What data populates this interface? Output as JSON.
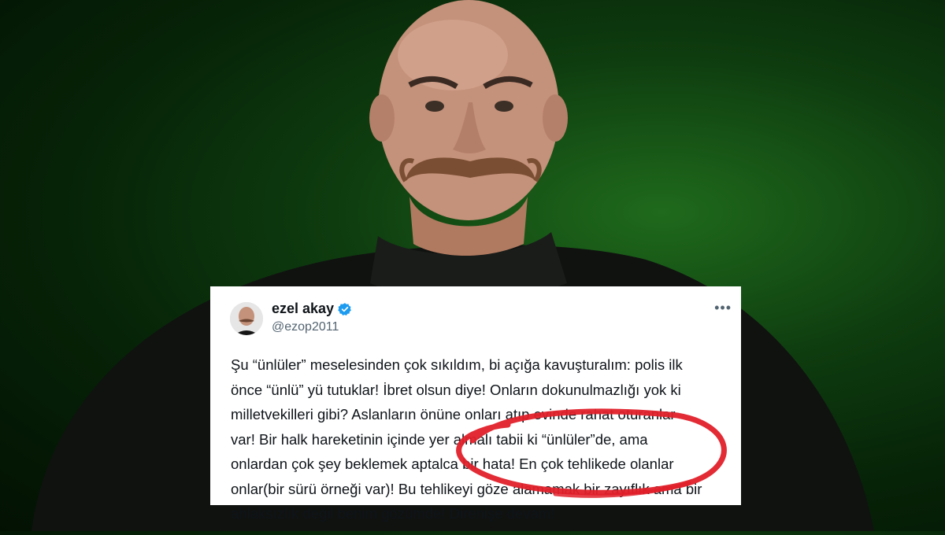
{
  "tweet": {
    "author_name": "ezel akay",
    "handle": "@ezop2011",
    "text": "Şu “ünlüler” meselesinden çok sıkıldım, bi açığa kavuşturalım: polis ilk\nönce “ünlü” yü tutuklar! İbret olsun diye! Onların dokunulmazlığı yok ki\nmilletvekilleri gibi? Aslanların önüne onları atıp evinde rahat oturanlar\nvar! Bir halk hareketinin içinde yer almalı tabii ki “ünlüler”de, ama\nonlardan çok şey beklemek aptalca bir hata! En çok tehlikede olanlar\nonlar(bir sürü örneği var)! Bu tehlikeyi göze alamamak bir zayıflık ama bir\nahlaksızlık değil benim gözümde! Direnişe devam!"
  },
  "icons": {
    "verified": "verified-badge-icon",
    "more": "more-options-icon"
  },
  "colors": {
    "background_green": "#0e3c0f",
    "verified_blue": "#1d9bf0",
    "annotation_red": "#e0202a",
    "text_primary": "#0f1419",
    "text_secondary": "#536471"
  }
}
